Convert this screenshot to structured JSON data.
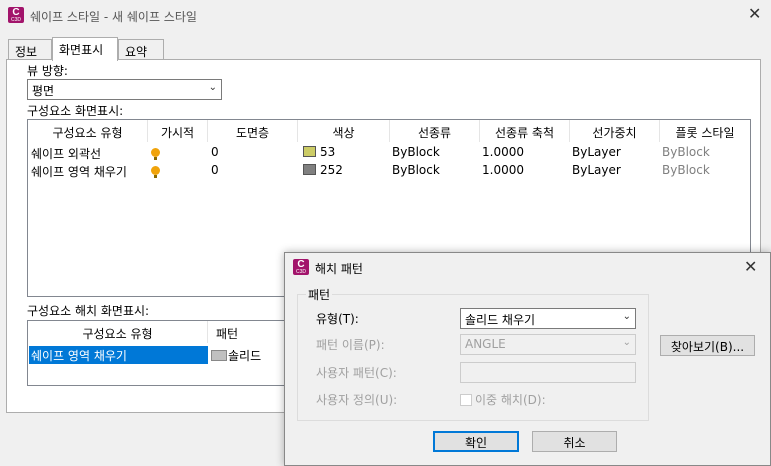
{
  "window": {
    "title": "쉐이프 스타일 - 새 쉐이프 스타일",
    "icon_letter": "C",
    "icon_sub": "C3D"
  },
  "tabs": [
    {
      "label": "정보"
    },
    {
      "label": "화면표시"
    },
    {
      "label": "요약"
    }
  ],
  "view": {
    "label": "뷰 방향:",
    "value": "평면"
  },
  "components_display": {
    "label": "구성요소 화면표시:",
    "columns": [
      "구성요소 유형",
      "가시적",
      "도면층",
      "색상",
      "선종류",
      "선종류 축척",
      "선가중치",
      "플롯 스타일"
    ],
    "rows": [
      {
        "type": "쉐이프 외곽선",
        "layer": "0",
        "color": "53",
        "color_hex": "#cccc66",
        "linetype": "ByBlock",
        "lt_scale": "1.0000",
        "lineweight": "ByLayer",
        "plot_style": "ByBlock"
      },
      {
        "type": "쉐이프 영역 채우기",
        "layer": "0",
        "color": "252",
        "color_hex": "#808080",
        "linetype": "ByBlock",
        "lt_scale": "1.0000",
        "lineweight": "ByLayer",
        "plot_style": "ByBlock"
      }
    ]
  },
  "components_hatch": {
    "label": "구성요소 해치 화면표시:",
    "columns": [
      "구성요소 유형",
      "패턴"
    ],
    "rows": [
      {
        "type": "쉐이프 영역 채우기",
        "pattern": "솔리드"
      }
    ]
  },
  "hatch_dialog": {
    "title": "해치 패턴",
    "group_label": "패턴",
    "type_label": "유형(T):",
    "type_value": "솔리드 채우기",
    "pattern_name_label": "패턴 이름(P):",
    "pattern_name_value": "ANGLE",
    "custom_pattern_label": "사용자 패턴(C):",
    "user_defined_label": "사용자 정의(U):",
    "double_hatch_label": "이중 해치(D):",
    "browse_button": "찾아보기(B)...",
    "ok_button": "확인",
    "cancel_button": "취소"
  },
  "colors": {
    "accent": "#0078d7",
    "icon_bg": "#a2146b",
    "bulb": "#f0a30a"
  }
}
